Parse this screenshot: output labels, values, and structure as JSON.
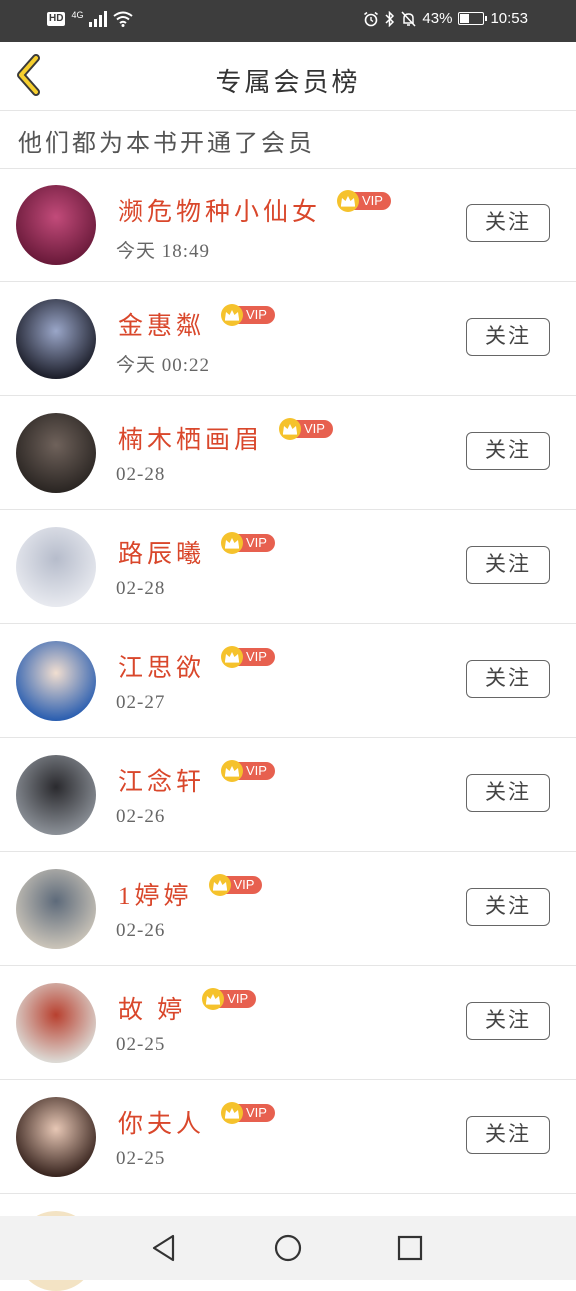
{
  "status_bar": {
    "hd": "HD",
    "network": "4G",
    "battery": "43%",
    "battery_fraction": 0.43,
    "time": "10:53"
  },
  "header": {
    "title": "专属会员榜",
    "back_icon": "chevron-left-icon"
  },
  "subtitle": "他们都为本书开通了会员",
  "vip_label": "VIP",
  "follow_label": "关注",
  "members": [
    {
      "name": "濒危物种小仙女",
      "time": "今天  18:49",
      "avatar_colors": [
        "#6a1a3a",
        "#c24b7a"
      ]
    },
    {
      "name": "金惠粼",
      "time": "今天  00:22",
      "avatar_colors": [
        "#1d1f2b",
        "#9aa6c8"
      ]
    },
    {
      "name": "楠木栖画眉",
      "time": "02-28",
      "avatar_colors": [
        "#2b2623",
        "#6f625b"
      ]
    },
    {
      "name": "路辰曦",
      "time": "02-28",
      "avatar_colors": [
        "#e7e9ef",
        "#b6bccb"
      ]
    },
    {
      "name": "江思欲",
      "time": "02-27",
      "avatar_colors": [
        "#2c5fb0",
        "#f1ded0"
      ]
    },
    {
      "name": "江念轩",
      "time": "02-26",
      "avatar_colors": [
        "#8a8f96",
        "#2a2a2e"
      ]
    },
    {
      "name": "1婷婷",
      "time": "02-26",
      "avatar_colors": [
        "#c9c3b8",
        "#5d6a7a"
      ]
    },
    {
      "name": "故  婷",
      "time": "02-25",
      "avatar_colors": [
        "#dcd9d4",
        "#b8402f"
      ]
    },
    {
      "name": "你夫人",
      "time": "02-25",
      "avatar_colors": [
        "#3a2620",
        "#e7c7b5"
      ]
    }
  ],
  "nav": {
    "back_icon": "triangle-back-icon",
    "home_icon": "circle-home-icon",
    "recent_icon": "square-recents-icon"
  }
}
